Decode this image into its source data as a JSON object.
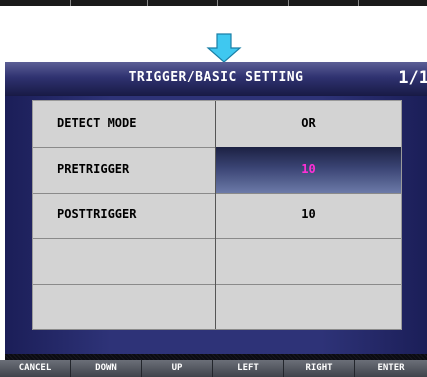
{
  "title": "TRIGGER/BASIC SETTING",
  "page_indicator": "1/1",
  "settings": [
    {
      "label": "DETECT MODE",
      "value": "OR"
    },
    {
      "label": "PRETRIGGER",
      "value": "10"
    },
    {
      "label": "POSTTRIGGER",
      "value": "10"
    },
    {
      "label": "",
      "value": ""
    },
    {
      "label": "",
      "value": ""
    }
  ],
  "selected_value_color": "#ff2fd6",
  "arrow_color": "#3fc8f0",
  "softkeys": [
    "CANCEL",
    "DOWN",
    "UP",
    "LEFT",
    "RIGHT",
    "ENTER"
  ]
}
